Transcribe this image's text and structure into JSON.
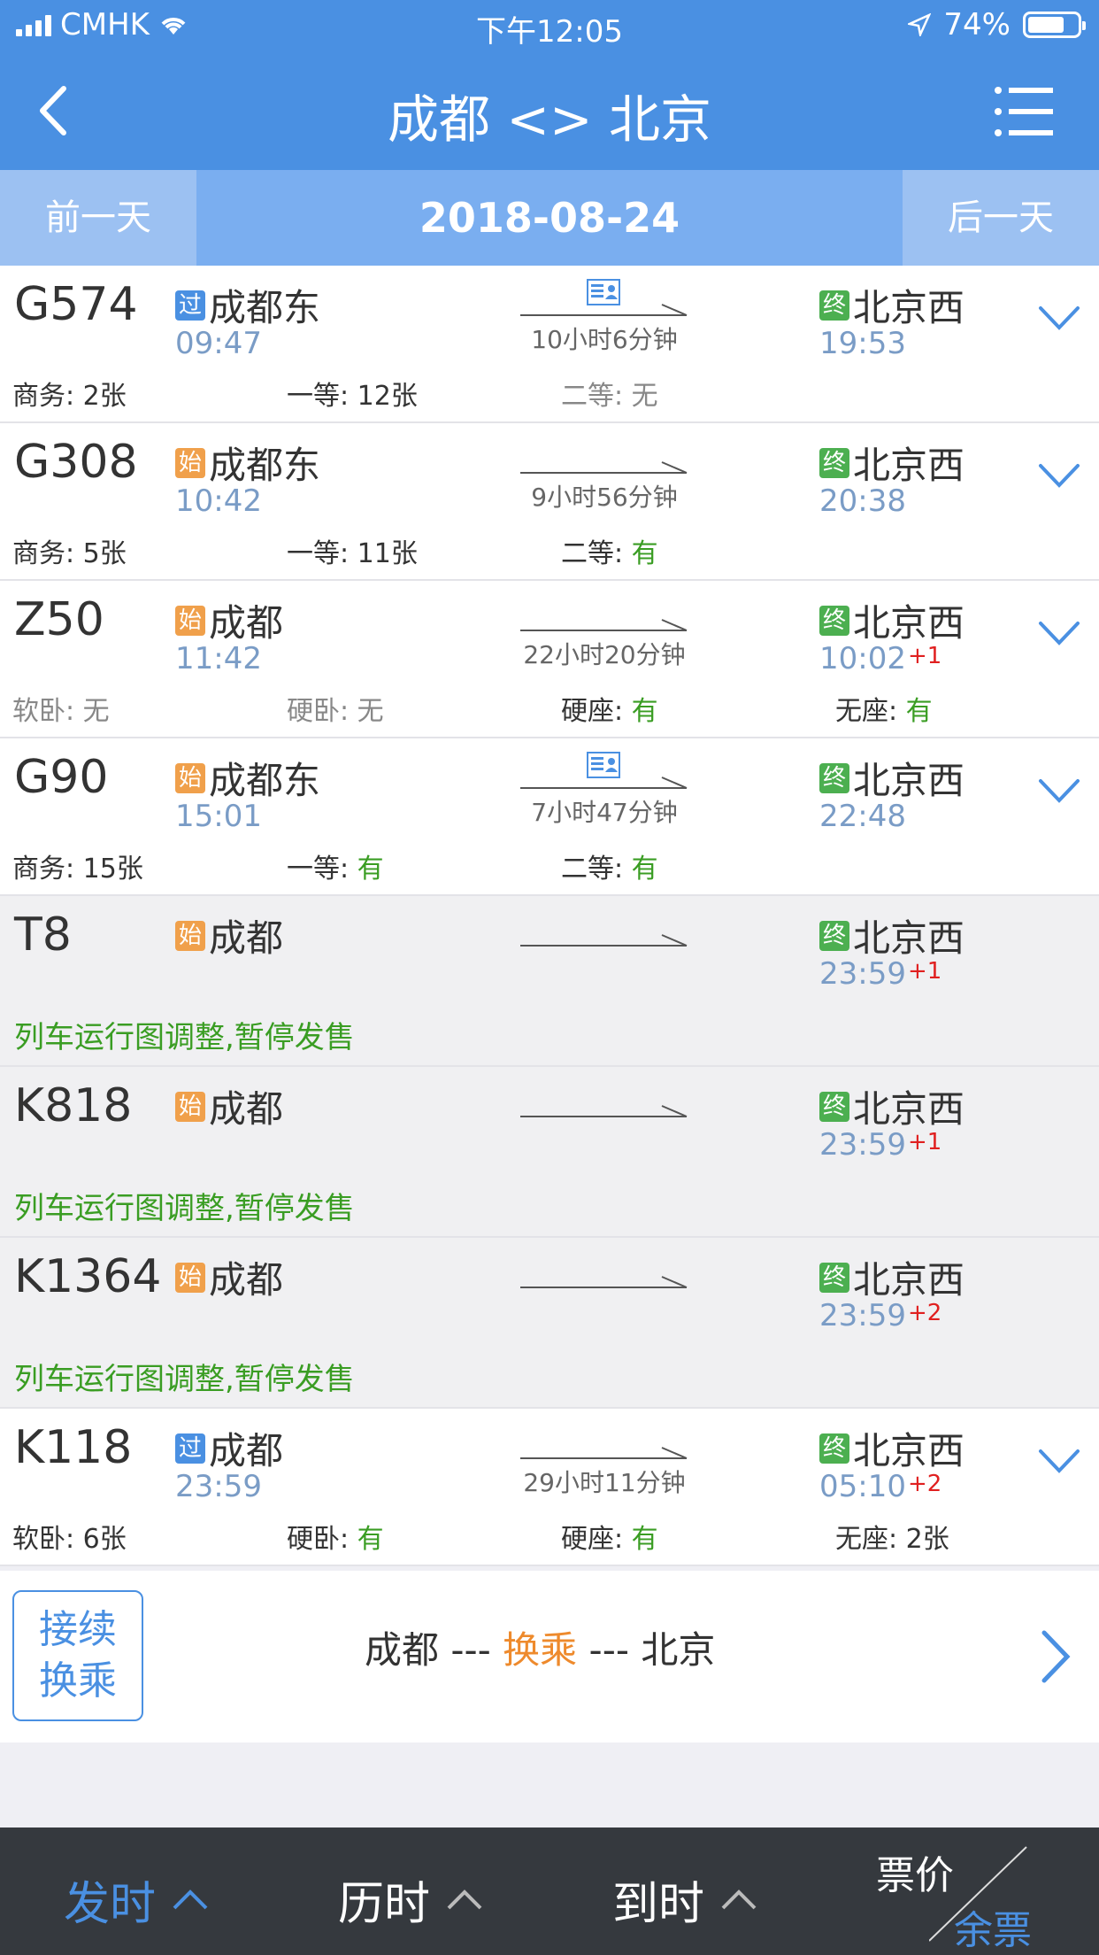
{
  "status_bar": {
    "carrier": "CMHK",
    "time": "下午12:05",
    "battery": "74%",
    "battery_level": 0.74
  },
  "header": {
    "title": "成都 <> 北京",
    "back_icon": "chevron-left-icon",
    "menu_icon": "list-menu-icon"
  },
  "date_bar": {
    "prev": "前一天",
    "date": "2018-08-24",
    "next": "后一天"
  },
  "trains": [
    {
      "no": "G574",
      "from_badge": "过",
      "from_type": "pass",
      "from": "成都东",
      "dep": "09:47",
      "has_ticket_icon": true,
      "duration": "10小时6分钟",
      "to_badge": "终",
      "to": "北京西",
      "arr": "19:53",
      "arr_plus": "",
      "grey": false,
      "suspend": "",
      "seats": [
        {
          "label": "商务: ",
          "value": "2张",
          "green": false,
          "muted": false
        },
        {
          "label": "一等: ",
          "value": "12张",
          "green": false,
          "muted": false
        },
        {
          "label": "二等: ",
          "value": "无",
          "green": false,
          "muted": true
        }
      ]
    },
    {
      "no": "G308",
      "from_badge": "始",
      "from_type": "start",
      "from": "成都东",
      "dep": "10:42",
      "has_ticket_icon": false,
      "duration": "9小时56分钟",
      "to_badge": "终",
      "to": "北京西",
      "arr": "20:38",
      "arr_plus": "",
      "grey": false,
      "suspend": "",
      "seats": [
        {
          "label": "商务: ",
          "value": "5张",
          "green": false,
          "muted": false
        },
        {
          "label": "一等: ",
          "value": "11张",
          "green": false,
          "muted": false
        },
        {
          "label": "二等: ",
          "value": "有",
          "green": true,
          "muted": false
        }
      ]
    },
    {
      "no": "Z50",
      "from_badge": "始",
      "from_type": "start",
      "from": "成都",
      "dep": "11:42",
      "has_ticket_icon": false,
      "duration": "22小时20分钟",
      "to_badge": "终",
      "to": "北京西",
      "arr": "10:02",
      "arr_plus": "+1",
      "grey": false,
      "suspend": "",
      "seats": [
        {
          "label": "软卧: ",
          "value": "无",
          "green": false,
          "muted": true
        },
        {
          "label": "硬卧: ",
          "value": "无",
          "green": false,
          "muted": true
        },
        {
          "label": "硬座: ",
          "value": "有",
          "green": true,
          "muted": false
        },
        {
          "label": "无座: ",
          "value": "有",
          "green": true,
          "muted": false
        }
      ]
    },
    {
      "no": "G90",
      "from_badge": "始",
      "from_type": "start",
      "from": "成都东",
      "dep": "15:01",
      "has_ticket_icon": true,
      "duration": "7小时47分钟",
      "to_badge": "终",
      "to": "北京西",
      "arr": "22:48",
      "arr_plus": "",
      "grey": false,
      "suspend": "",
      "seats": [
        {
          "label": "商务: ",
          "value": "15张",
          "green": false,
          "muted": false
        },
        {
          "label": "一等: ",
          "value": "有",
          "green": true,
          "muted": false
        },
        {
          "label": "二等: ",
          "value": "有",
          "green": true,
          "muted": false
        }
      ]
    },
    {
      "no": "T8",
      "from_badge": "始",
      "from_type": "start",
      "from": "成都",
      "dep": "",
      "has_ticket_icon": false,
      "duration": "",
      "to_badge": "终",
      "to": "北京西",
      "arr": "23:59",
      "arr_plus": "+1",
      "grey": true,
      "suspend": "列车运行图调整,暂停发售",
      "seats": []
    },
    {
      "no": "K818",
      "from_badge": "始",
      "from_type": "start",
      "from": "成都",
      "dep": "",
      "has_ticket_icon": false,
      "duration": "",
      "to_badge": "终",
      "to": "北京西",
      "arr": "23:59",
      "arr_plus": "+1",
      "grey": true,
      "suspend": "列车运行图调整,暂停发售",
      "seats": []
    },
    {
      "no": "K1364",
      "from_badge": "始",
      "from_type": "start",
      "from": "成都",
      "dep": "",
      "has_ticket_icon": false,
      "duration": "",
      "to_badge": "终",
      "to": "北京西",
      "arr": "23:59",
      "arr_plus": "+2",
      "grey": true,
      "suspend": "列车运行图调整,暂停发售",
      "seats": []
    },
    {
      "no": "K118",
      "from_badge": "过",
      "from_type": "pass",
      "from": "成都",
      "dep": "23:59",
      "has_ticket_icon": false,
      "duration": "29小时11分钟",
      "to_badge": "终",
      "to": "北京西",
      "arr": "05:10",
      "arr_plus": "+2",
      "grey": false,
      "suspend": "",
      "seats": [
        {
          "label": "软卧: ",
          "value": "6张",
          "green": false,
          "muted": false
        },
        {
          "label": "硬卧: ",
          "value": "有",
          "green": true,
          "muted": false
        },
        {
          "label": "硬座: ",
          "value": "有",
          "green": true,
          "muted": false
        },
        {
          "label": "无座: ",
          "value": "2张",
          "green": false,
          "muted": false
        }
      ]
    }
  ],
  "transfer": {
    "box_line1": "接续",
    "box_line2": "换乘",
    "from": "成都 --- ",
    "mid": "换乘",
    "to": " --- 北京"
  },
  "tabbar": {
    "tab1": "发时",
    "tab2": "历时",
    "tab3": "到时",
    "price": "票价",
    "remain": "余票"
  },
  "colors": {
    "primary": "#4a90e2",
    "green": "#3a9d23",
    "orange": "#f0a04b",
    "red": "#e02020",
    "tabbar_bg": "#35393e"
  }
}
